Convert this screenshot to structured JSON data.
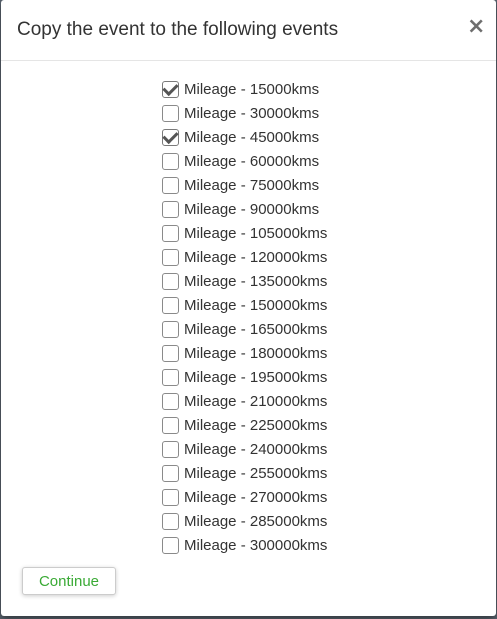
{
  "dialog": {
    "title": "Copy the event to the following events",
    "close_label": "×",
    "continue_label": "Continue"
  },
  "events": [
    {
      "label": "Mileage - 15000kms",
      "checked": true
    },
    {
      "label": "Mileage - 30000kms",
      "checked": false
    },
    {
      "label": "Mileage - 45000kms",
      "checked": true
    },
    {
      "label": "Mileage - 60000kms",
      "checked": false
    },
    {
      "label": "Mileage - 75000kms",
      "checked": false
    },
    {
      "label": "Mileage - 90000kms",
      "checked": false
    },
    {
      "label": "Mileage - 105000kms",
      "checked": false
    },
    {
      "label": "Mileage - 120000kms",
      "checked": false
    },
    {
      "label": "Mileage - 135000kms",
      "checked": false
    },
    {
      "label": "Mileage - 150000kms",
      "checked": false
    },
    {
      "label": "Mileage - 165000kms",
      "checked": false
    },
    {
      "label": "Mileage - 180000kms",
      "checked": false
    },
    {
      "label": "Mileage - 195000kms",
      "checked": false
    },
    {
      "label": "Mileage - 210000kms",
      "checked": false
    },
    {
      "label": "Mileage - 225000kms",
      "checked": false
    },
    {
      "label": "Mileage - 240000kms",
      "checked": false
    },
    {
      "label": "Mileage - 255000kms",
      "checked": false
    },
    {
      "label": "Mileage - 270000kms",
      "checked": false
    },
    {
      "label": "Mileage - 285000kms",
      "checked": false
    },
    {
      "label": "Mileage - 300000kms",
      "checked": false
    }
  ],
  "colors": {
    "continue_text": "#3aaa35",
    "title_text": "#333333"
  }
}
